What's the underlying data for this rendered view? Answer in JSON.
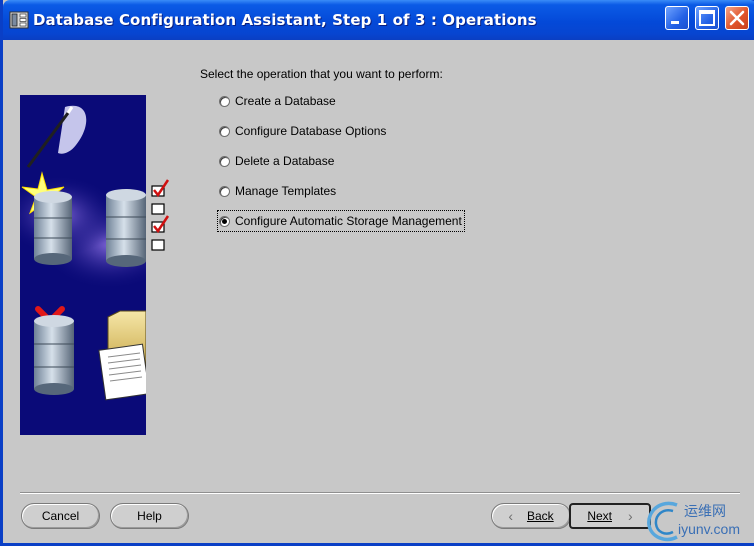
{
  "window": {
    "title": "Database Configuration Assistant, Step 1 of 3 : Operations"
  },
  "main": {
    "prompt": "Select the operation that you want to perform:",
    "options": [
      {
        "label": "Create a Database",
        "selected": false
      },
      {
        "label": "Configure Database Options",
        "selected": false
      },
      {
        "label": "Delete a Database",
        "selected": false
      },
      {
        "label": "Manage Templates",
        "selected": false
      },
      {
        "label": "Configure Automatic Storage Management",
        "selected": true
      }
    ]
  },
  "buttons": {
    "cancel": "Cancel",
    "help": "Help",
    "back": "Back",
    "next": "Next"
  },
  "watermark": {
    "cn": "运维网",
    "url": "iyunv.com"
  },
  "colors": {
    "titlebar": "#0449d8",
    "client_bg": "#c8c8c8",
    "illustration_bg": "#0a0a78",
    "watermark": "#3a6fb5"
  },
  "icons": [
    "app-icon",
    "minimize-icon",
    "maximize-icon",
    "close-icon",
    "back-arrow-icon",
    "next-arrow-icon"
  ]
}
